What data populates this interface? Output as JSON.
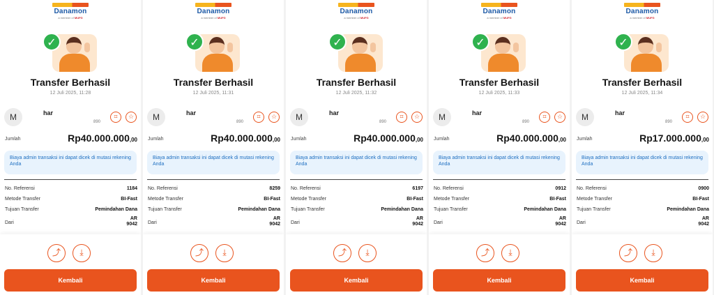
{
  "brand": {
    "name": "Danamon",
    "tagline_prefix": "a member of",
    "tagline_group": "MUFG"
  },
  "common": {
    "title": "Transfer Berhasil",
    "amount_label": "Jumlah",
    "info_text": "Biaya admin transaksi ini dapat dicek di mutasi rekening Anda",
    "labels": {
      "reference": "No. Referensi",
      "method": "Metode Transfer",
      "purpose": "Tujuan Transfer",
      "from": "Dari"
    },
    "back_label": "Kembali",
    "avatar_initial": "M",
    "recipient_name": "har",
    "recipient_account": "890"
  },
  "receipts": [
    {
      "date": "12 Juli 2025, 11:28",
      "amount": "Rp40.000.000",
      "decimals": ",00",
      "reference": "1184",
      "method": "BI-Fast",
      "purpose": "Pemindahan Dana",
      "from_name": "AR",
      "from_account": "9042"
    },
    {
      "date": "12 Juli 2025, 11:31",
      "amount": "Rp40.000.000",
      "decimals": ",00",
      "reference": "8259",
      "method": "BI-Fast",
      "purpose": "Pemindahan Dana",
      "from_name": "AR",
      "from_account": "9042"
    },
    {
      "date": "12 Juli 2025, 11:32",
      "amount": "Rp40.000.000",
      "decimals": ",00",
      "reference": "6197",
      "method": "BI-Fast",
      "purpose": "Pemindahan Dana",
      "from_name": "AR",
      "from_account": "9042"
    },
    {
      "date": "12 Juli 2025, 11:33",
      "amount": "Rp40.000.000",
      "decimals": ",00",
      "reference": "0912",
      "method": "BI-Fast",
      "purpose": "Pemindahan Dana",
      "from_name": "AR",
      "from_account": "9042"
    },
    {
      "date": "12 Juli 2025, 11:34",
      "amount": "Rp17.000.000",
      "decimals": ",00",
      "reference": "0900",
      "method": "BI-Fast",
      "purpose": "Pemindahan Dana",
      "from_name": "AR",
      "from_account": "9042"
    }
  ],
  "icons": {
    "success": "check-circle-icon",
    "favorite": "star-icon",
    "tag": "tag-icon",
    "share": "share-icon",
    "download": "download-icon"
  },
  "colors": {
    "accent": "#e9541e",
    "success": "#2fb24e",
    "info_bg": "#e8f3fd",
    "info_text": "#1e6fc1",
    "brand_blue": "#1d5aa6"
  }
}
